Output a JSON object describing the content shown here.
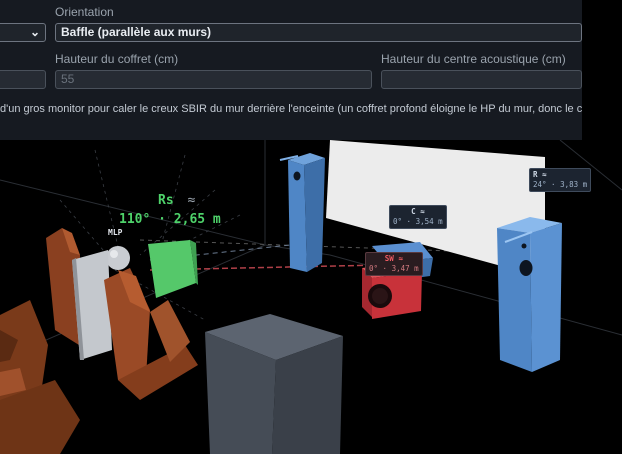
{
  "form": {
    "orientation_label": "Orientation",
    "orientation_value": "Baffle (parallèle aux murs)",
    "height_label": "Hauteur du coffret (cm)",
    "height_value": "55",
    "center_label": "Hauteur du centre acoustique (cm)",
    "note": "d'un gros monitor pour caler le creux SBIR du mur derrière l'enceinte (un coffret profond éloigne le HP du mur, donc le c"
  },
  "scene": {
    "rs_label": "Rs",
    "rs_approx": "≈",
    "rs_value": "110° · 2,65 m",
    "mlp_label": "MLP",
    "tags": {
      "r_title": "R",
      "r_approx": "≈",
      "r_value": "24° · 3,83 m",
      "c_title": "C",
      "c_approx": "≈",
      "c_value": "0° · 3,54 m",
      "sw_title": "SW",
      "sw_approx": "≈",
      "sw_value": "0° · 3,47 m"
    }
  },
  "colors": {
    "speaker": "#4f86c6",
    "sub": "#c8323a",
    "rs_speaker": "#3fbf55",
    "seat": "#9a4a26",
    "screen": "#ececec",
    "panel": "#161a21"
  }
}
